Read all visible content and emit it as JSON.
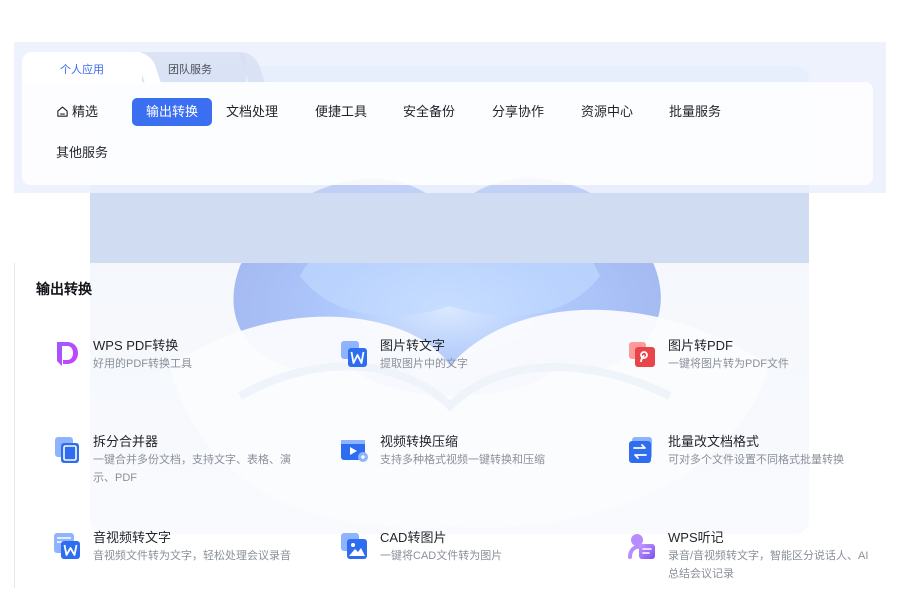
{
  "tabs": [
    {
      "label": "个人应用",
      "active": true
    },
    {
      "label": "团队服务",
      "active": false
    }
  ],
  "categories": [
    {
      "label": "精选",
      "icon": "home-icon",
      "active": false
    },
    {
      "label": "输出转换",
      "active": true
    },
    {
      "label": "文档处理",
      "active": false
    },
    {
      "label": "便捷工具",
      "active": false
    },
    {
      "label": "安全备份",
      "active": false
    },
    {
      "label": "分享协作",
      "active": false
    },
    {
      "label": "资源中心",
      "active": false
    },
    {
      "label": "批量服务",
      "active": false
    },
    {
      "label": "其他服务",
      "active": false
    }
  ],
  "section": {
    "title": "输出转换",
    "tools": [
      {
        "title": "WPS PDF转换",
        "desc": "好用的PDF转换工具",
        "icon": "wps-pdf-icon"
      },
      {
        "title": "图片转文字",
        "desc": "提取图片中的文字",
        "icon": "image-to-text-icon"
      },
      {
        "title": "图片转PDF",
        "desc": "一键将图片转为PDF文件",
        "icon": "image-to-pdf-icon"
      },
      {
        "title": "拆分合并器",
        "desc": "一键合并多份文档，支持文字、表格、演示、PDF",
        "icon": "split-merge-icon"
      },
      {
        "title": "视频转换压缩",
        "desc": "支持多种格式视频一键转换和压缩",
        "icon": "video-convert-icon"
      },
      {
        "title": "批量改文档格式",
        "desc": "可对多个文件设置不同格式批量转换",
        "icon": "batch-format-icon"
      },
      {
        "title": "音视频转文字",
        "desc": "音视频文件转为文字，轻松处理会议录音",
        "icon": "audio-to-text-icon"
      },
      {
        "title": "CAD转图片",
        "desc": "一键将CAD文件转为图片",
        "icon": "cad-to-image-icon"
      },
      {
        "title": "WPS听记",
        "desc": "录音/音视频转文字，智能区分说话人、AI总结会议记录",
        "icon": "wps-tingji-icon"
      }
    ]
  },
  "colors": {
    "accent": "#3b6ff2",
    "red_icon": "#e8454a",
    "purple_icon": "#7a4df0",
    "text_secondary": "#8a8f99"
  }
}
